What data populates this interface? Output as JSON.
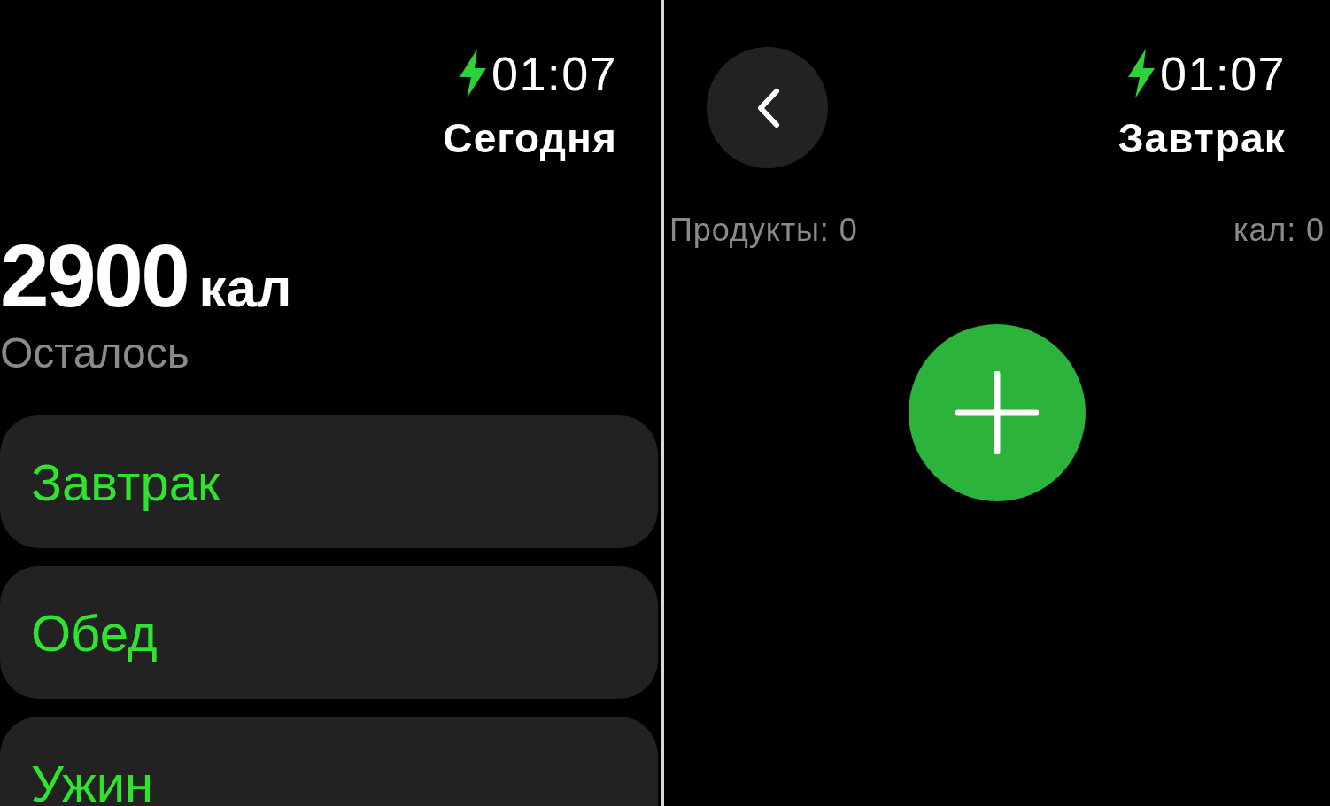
{
  "today": {
    "status": {
      "charging": true,
      "time": "01:07"
    },
    "title": "Сегодня",
    "remaining": {
      "value": "2900",
      "unit": "кал",
      "label": "Осталось"
    },
    "meals": [
      {
        "label": "Завтрак"
      },
      {
        "label": "Обед"
      },
      {
        "label": "Ужин"
      }
    ]
  },
  "meal_detail": {
    "status": {
      "charging": true,
      "time": "01:07"
    },
    "title": "Завтрак",
    "products": "Продукты: 0",
    "calories": "кал: 0"
  }
}
